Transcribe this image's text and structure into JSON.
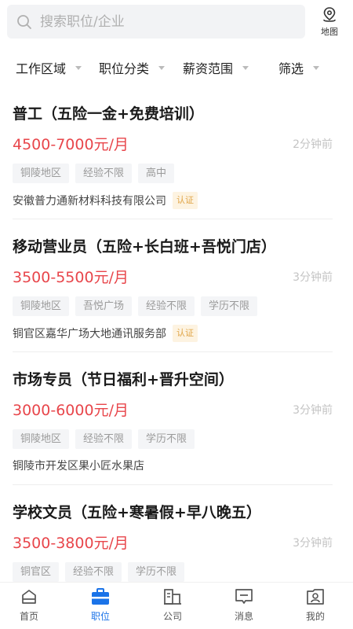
{
  "search": {
    "placeholder": "搜索职位/企业"
  },
  "map_button": {
    "label": "地图"
  },
  "filters": [
    {
      "label": "工作区域"
    },
    {
      "label": "职位分类"
    },
    {
      "label": "薪资范围"
    },
    {
      "label": "筛选"
    }
  ],
  "jobs": [
    {
      "title": "普工（五险一金+免费培训）",
      "salary": "4500-7000元/月",
      "time": "2分钟前",
      "tags": [
        "铜陵地区",
        "经验不限",
        "高中"
      ],
      "company": "安徽普力通新材料科技有限公司",
      "badge": "认证"
    },
    {
      "title": "移动营业员（五险+长白班+吾悦门店）",
      "salary": "3500-5500元/月",
      "time": "3分钟前",
      "tags": [
        "铜陵地区",
        "吾悦广场",
        "经验不限",
        "学历不限"
      ],
      "company": "铜官区嘉华广场大地通讯服务部",
      "badge": "认证"
    },
    {
      "title": "市场专员（节日福利+晋升空间）",
      "salary": "3000-6000元/月",
      "time": "3分钟前",
      "tags": [
        "铜陵地区",
        "经验不限",
        "学历不限"
      ],
      "company": "铜陵市开发区果小匠水果店"
    },
    {
      "title": "学校文员（五险+寒暑假+早八晚五）",
      "salary": "3500-3800元/月",
      "time": "3分钟前",
      "tags": [
        "铜官区",
        "经验不限",
        "学历不限"
      ]
    }
  ],
  "tabbar": [
    {
      "label": "首页",
      "icon": "home-icon"
    },
    {
      "label": "职位",
      "icon": "briefcase-icon",
      "active": true
    },
    {
      "label": "公司",
      "icon": "building-icon"
    },
    {
      "label": "消息",
      "icon": "message-icon"
    },
    {
      "label": "我的",
      "icon": "profile-icon"
    }
  ],
  "colors": {
    "accent": "#1a73e8",
    "salary": "#e8464b",
    "badge_text": "#e0a548",
    "badge_bg": "#fdf3e1"
  }
}
